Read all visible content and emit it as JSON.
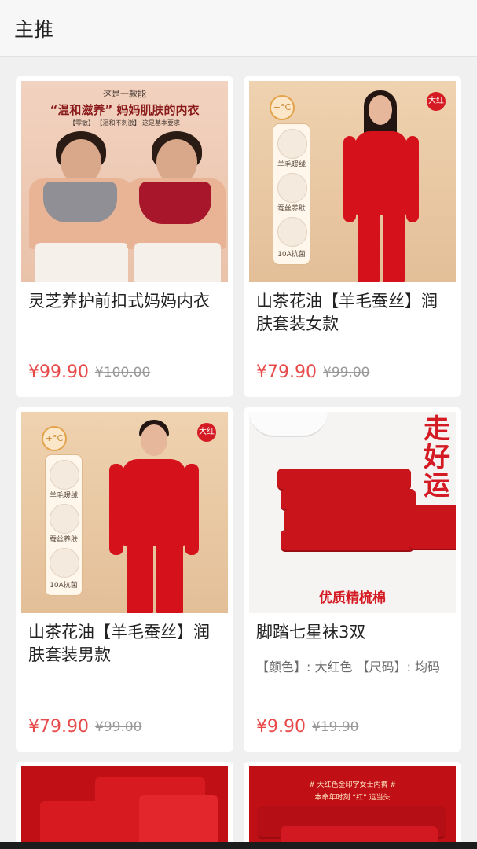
{
  "header": {
    "title": "主推"
  },
  "products": [
    {
      "title": "灵芝养护前扣式妈妈内衣",
      "price": "¥99.90",
      "original_price": "¥100.00",
      "image": {
        "line1": "这是一款能",
        "line2": "“温和滋养” 妈妈肌肤的内衣",
        "line3": "【零敏】 【温和不刺激】 这是基本要求"
      }
    },
    {
      "title": "山茶花油【羊毛蚕丝】润肤套装女款",
      "price": "¥79.90",
      "original_price": "¥99.00",
      "image": {
        "badge": "大红",
        "temp": "+°C",
        "features": [
          "羊毛暖绒",
          "蚕丝养肤",
          "10A抗菌"
        ]
      }
    },
    {
      "title": "山茶花油【羊毛蚕丝】润肤套装男款",
      "price": "¥79.90",
      "original_price": "¥99.00",
      "image": {
        "badge": "大红",
        "temp": "+°C",
        "features": [
          "羊毛暖绒",
          "蚕丝养肤",
          "10A抗菌"
        ]
      }
    },
    {
      "title": "脚踏七星袜3双",
      "spec": "【颜色】: 大红色 【尺码】: 均码",
      "price": "¥9.90",
      "original_price": "¥19.90",
      "image": {
        "slogan": [
          "走",
          "好",
          "运"
        ],
        "banner": "优质精梳棉"
      }
    },
    {
      "image": {}
    },
    {
      "image": {
        "line1": "# 大红色金印字女士内裤 #",
        "line2": "本命年时刻 “红” 运当头"
      }
    }
  ],
  "colors": {
    "price": "#e84a4a",
    "accent_red": "#d41a22"
  }
}
